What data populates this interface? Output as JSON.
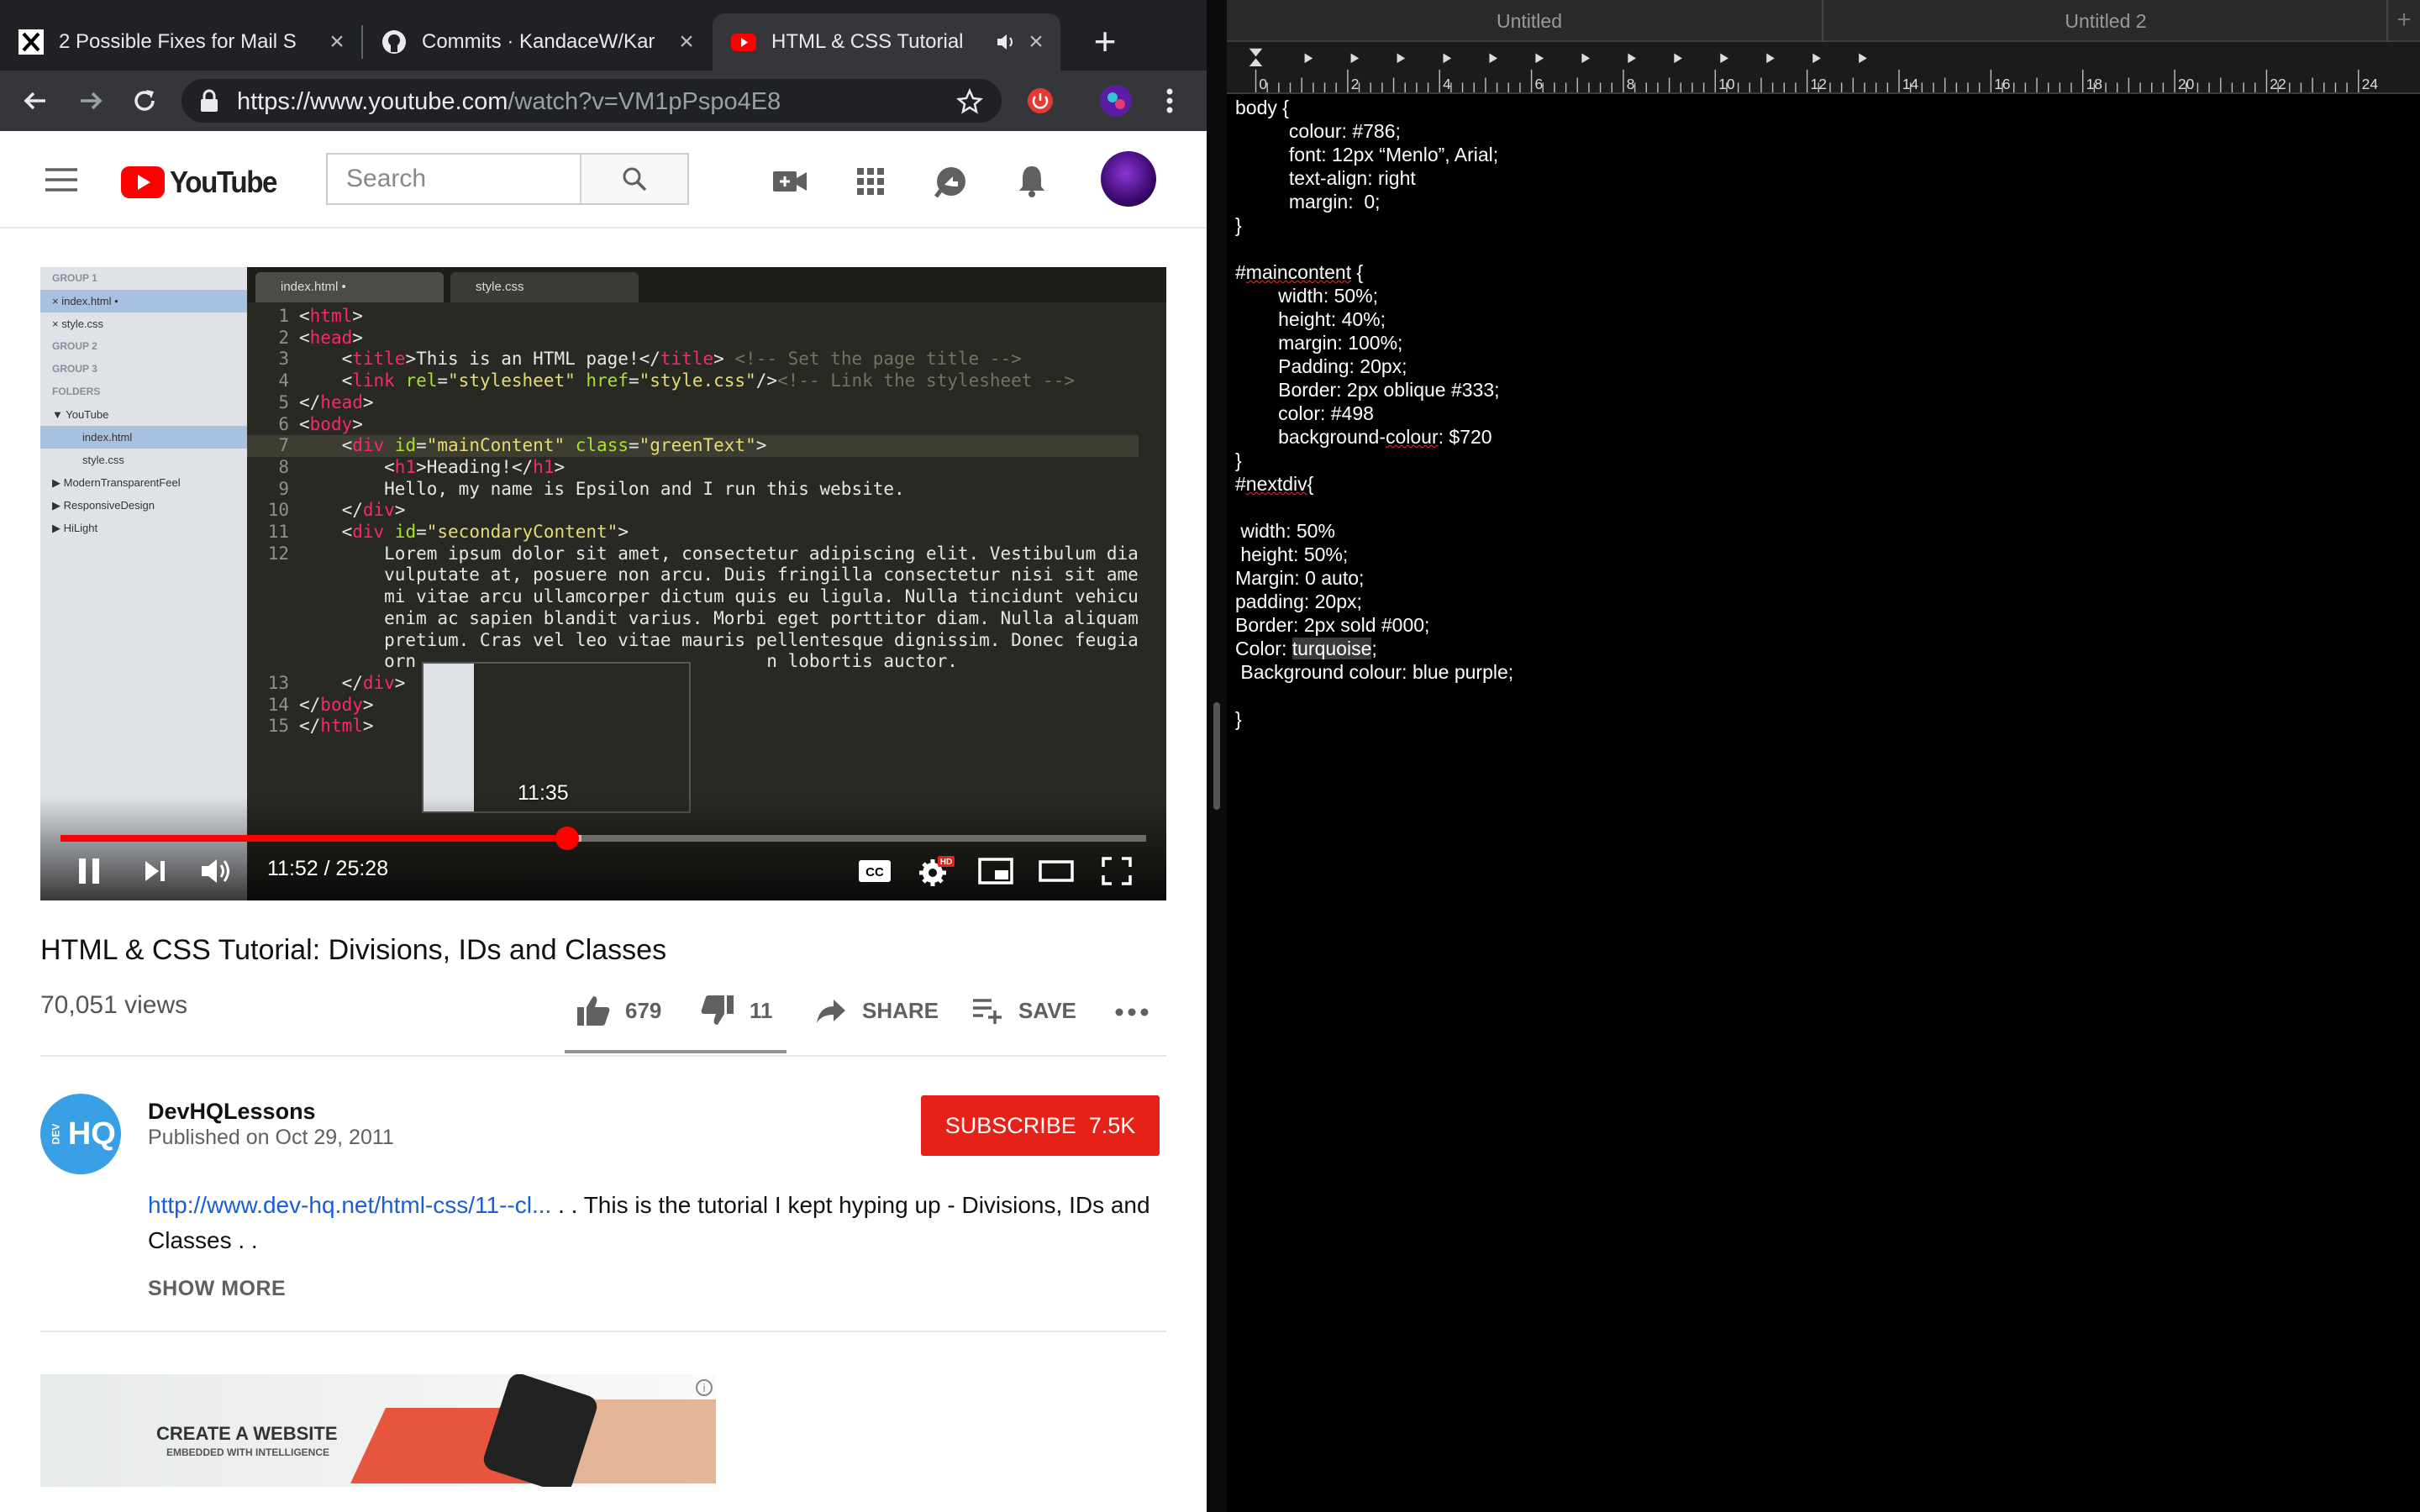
{
  "browser": {
    "tabs": [
      {
        "title": "2 Possible Fixes for Mail S",
        "icon": "x-logo-icon"
      },
      {
        "title": "Commits · KandaceW/Kar",
        "icon": "github-icon"
      },
      {
        "title": "HTML & CSS Tutorial",
        "icon": "youtube-icon"
      }
    ],
    "url_host": "https://www.youtube.com",
    "url_path": "/watch?v=VM1pPspo4E8"
  },
  "youtube": {
    "logo_text": "YouTube",
    "search_placeholder": "Search",
    "player": {
      "preview_time": "11:35",
      "time_display": "11:52 / 25:28",
      "progress_fraction": 0.467,
      "buffered_fraction": 0.48
    },
    "video_title": "HTML & CSS Tutorial: Divisions, IDs and Classes",
    "views": "70,051 views",
    "likes": "679",
    "dislikes": "11",
    "share_label": "SHARE",
    "save_label": "SAVE",
    "channel": {
      "avatar_text": "HQ",
      "avatar_side_text": "DEV",
      "name": "DevHQLessons",
      "published": "Published on Oct 29, 2011"
    },
    "subscribe_label": "SUBSCRIBE",
    "subscriber_count": "7.5K",
    "description_link": "http://www.dev-hq.net/html-css/11--cl...",
    "description_text": " . . This is the tutorial I kept hyping up - Divisions, IDs and Classes . .",
    "show_more": "SHOW MORE",
    "ad": {
      "headline": "CREATE A WEBSITE",
      "subline": "EMBEDDED WITH INTELLIGENCE",
      "info": "i"
    }
  },
  "video_editor": {
    "tabs": [
      "index.html •",
      "style.css"
    ],
    "sidebar": [
      {
        "label": "GROUP 1",
        "kind": "grp"
      },
      {
        "label": "× index.html •",
        "kind": "sel"
      },
      {
        "label": "× style.css",
        "kind": "item"
      },
      {
        "label": "GROUP 2",
        "kind": "grp"
      },
      {
        "label": "GROUP 3",
        "kind": "grp"
      },
      {
        "label": "FOLDERS",
        "kind": "grp"
      },
      {
        "label": "▼ YouTube",
        "kind": "item"
      },
      {
        "label": "index.html",
        "kind": "sel2"
      },
      {
        "label": "style.css",
        "kind": "sub"
      },
      {
        "label": "▶ ModernTransparentFeel",
        "kind": "item"
      },
      {
        "label": "▶ ResponsiveDesign",
        "kind": "item"
      },
      {
        "label": "▶ HiLight",
        "kind": "item"
      }
    ],
    "code_lines": [
      {
        "n": "1",
        "segs": [
          [
            "",
            "<"
          ],
          [
            "tg",
            "html"
          ],
          [
            "",
            ">"
          ]
        ]
      },
      {
        "n": "2",
        "segs": [
          [
            "",
            "<"
          ],
          [
            "tg",
            "head"
          ],
          [
            "",
            ">"
          ]
        ]
      },
      {
        "n": "3",
        "segs": [
          [
            "",
            "    <"
          ],
          [
            "tg",
            "title"
          ],
          [
            "",
            ">This is an HTML page!</"
          ],
          [
            "tg",
            "title"
          ],
          [
            "",
            "> "
          ],
          [
            "cm",
            "<!-- Set the page title -->"
          ]
        ]
      },
      {
        "n": "4",
        "segs": [
          [
            "",
            "    <"
          ],
          [
            "tg",
            "link"
          ],
          [
            "at",
            " rel"
          ],
          [
            "",
            "="
          ],
          [
            "st",
            "\"stylesheet\""
          ],
          [
            "at",
            " href"
          ],
          [
            "",
            "="
          ],
          [
            "st",
            "\"style.css\""
          ],
          [
            "",
            "/>"
          ],
          [
            "cm",
            "<!-- Link the stylesheet -->"
          ]
        ]
      },
      {
        "n": "5",
        "segs": [
          [
            "",
            "</"
          ],
          [
            "tg",
            "head"
          ],
          [
            "",
            ">"
          ]
        ]
      },
      {
        "n": "6",
        "segs": [
          [
            "",
            "<"
          ],
          [
            "tg",
            "body"
          ],
          [
            "",
            ">"
          ]
        ]
      },
      {
        "n": "7",
        "cur": true,
        "segs": [
          [
            "",
            "    <"
          ],
          [
            "tg",
            "div"
          ],
          [
            "at",
            " id"
          ],
          [
            "",
            "="
          ],
          [
            "st",
            "\"mainContent\""
          ],
          [
            "at",
            " class"
          ],
          [
            "",
            "="
          ],
          [
            "st",
            "\"greenText\""
          ],
          [
            "",
            ">"
          ]
        ]
      },
      {
        "n": "8",
        "segs": [
          [
            "",
            "        <"
          ],
          [
            "tg",
            "h1"
          ],
          [
            "",
            ">Heading!</"
          ],
          [
            "tg",
            "h1"
          ],
          [
            "",
            ">"
          ]
        ]
      },
      {
        "n": "9",
        "segs": [
          [
            "",
            "        Hello, my name is Epsilon and I run this website."
          ]
        ]
      },
      {
        "n": "10",
        "segs": [
          [
            "",
            "    </"
          ],
          [
            "tg",
            "div"
          ],
          [
            "",
            ">"
          ]
        ]
      },
      {
        "n": "11",
        "segs": [
          [
            "",
            "    <"
          ],
          [
            "tg",
            "div"
          ],
          [
            "at",
            " id"
          ],
          [
            "",
            "="
          ],
          [
            "st",
            "\"secondaryContent\""
          ],
          [
            "",
            ">"
          ]
        ]
      },
      {
        "n": "12",
        "segs": [
          [
            "",
            "        Lorem ipsum dolor sit amet, consectetur adipiscing elit. Vestibulum dia"
          ]
        ]
      },
      {
        "n": "",
        "segs": [
          [
            "",
            "        vulputate at, posuere non arcu. Duis fringilla consectetur nisi sit ame"
          ]
        ]
      },
      {
        "n": "",
        "segs": [
          [
            "",
            "        mi vitae arcu ullamcorper dictum quis eu ligula. Nulla tincidunt vehicu"
          ]
        ]
      },
      {
        "n": "",
        "segs": [
          [
            "",
            "        enim ac sapien blandit varius. Morbi eget porttitor diam. Nulla aliquam"
          ]
        ]
      },
      {
        "n": "",
        "segs": [
          [
            "",
            "        pretium. Cras vel leo vitae mauris pellentesque dignissim. Donec feugia"
          ]
        ]
      },
      {
        "n": "",
        "segs": [
          [
            "",
            "        orn                                 n lobortis auctor."
          ]
        ]
      },
      {
        "n": "13",
        "segs": [
          [
            "",
            "    </"
          ],
          [
            "tg",
            "div"
          ],
          [
            "",
            ">"
          ]
        ]
      },
      {
        "n": "14",
        "segs": [
          [
            "",
            "</"
          ],
          [
            "tg",
            "body"
          ],
          [
            "",
            ">"
          ]
        ]
      },
      {
        "n": "15",
        "segs": [
          [
            "",
            "</"
          ],
          [
            "tg",
            "html"
          ],
          [
            "",
            ">"
          ]
        ]
      }
    ]
  },
  "text_editor": {
    "tabs": [
      "Untitled",
      "Untitled 2"
    ],
    "ruler_labels": [
      "0",
      "2",
      "4",
      "6",
      "8",
      "10",
      "12",
      "14",
      "16",
      "18",
      "20",
      "22",
      "24"
    ],
    "lines": [
      "body {",
      "          colour: #786;",
      "          font: 12px “Menlo”, Arial;",
      "          text-align: right",
      "          margin:  0;",
      "}",
      "",
      "#maincontent {",
      "        width: 50%;",
      "        height: 40%;",
      "        margin: 100%;",
      "        Padding: 20px;",
      "        Border: 2px oblique #333;",
      "        color: #498",
      "        background-colour: $720",
      "}",
      "#nextdiv{",
      "",
      " width: 50%",
      " height: 50%;",
      "Margin: 0 auto;",
      "padding: 20px;",
      "Border: 2px sold #000;",
      "Color: turquoise;",
      " Background colour: blue purple;",
      "",
      "}"
    ]
  }
}
